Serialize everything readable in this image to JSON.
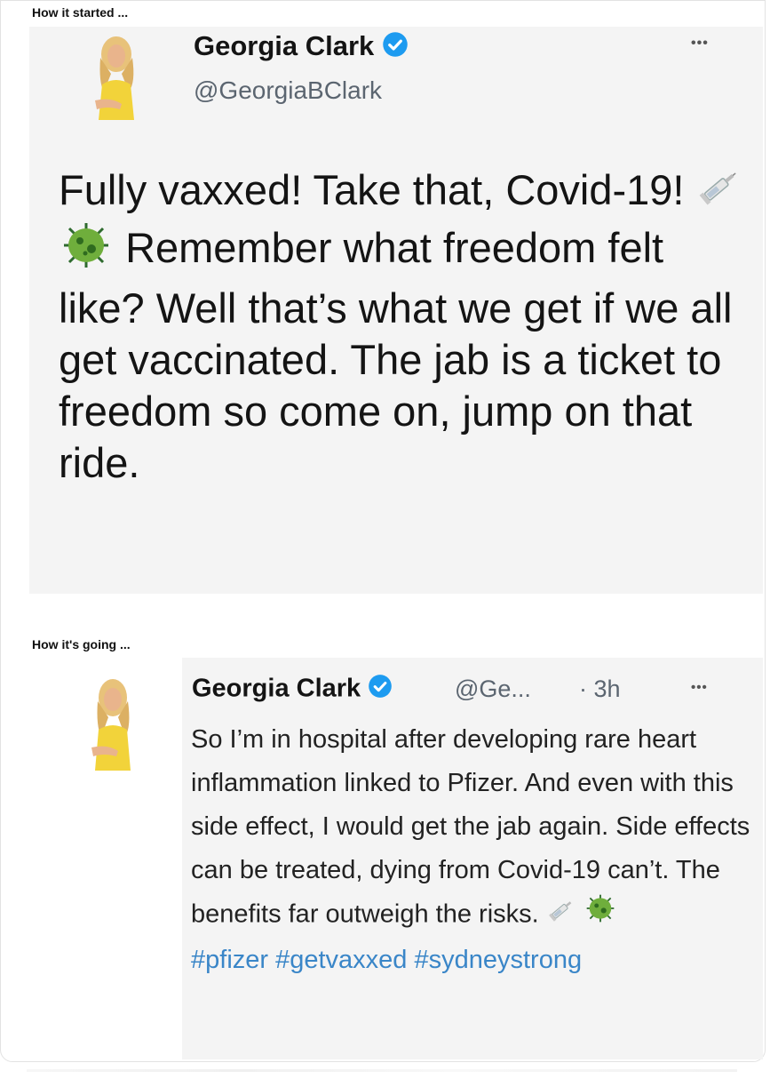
{
  "captions": {
    "started": "How it started ...",
    "going": "How it's going ..."
  },
  "tweet1": {
    "name": "Georgia Clark",
    "handle": "@GeorgiaBClark",
    "more": "•••",
    "text_part1": "Fully vaxxed! Take that, Covid-19!",
    "text_part2": "Remember what freedom felt like? Well that’s what we get if we all get vaccinated. The jab is a ticket to freedom so come on, jump on that ride.",
    "emojis": [
      "syringe-icon",
      "microbe-icon"
    ]
  },
  "tweet2": {
    "name": "Georgia Clark",
    "handle": "@Ge...",
    "time": "· 3h",
    "more": "•••",
    "text": "So I’m in hospital after developing rare heart inflammation linked to Pfizer. And even with this side effect, I would get the jab again. Side effects can be treated, dying from Covid-19 can’t. The benefits far outweigh the risks.",
    "hashtags": "#pfizer #getvaxxed #sydneystrong",
    "emojis": [
      "syringe-icon",
      "microbe-icon"
    ]
  },
  "colors": {
    "verified": "#1d9bf0",
    "hashtag": "#3a86c8",
    "card_bg": "#f4f4f4"
  }
}
